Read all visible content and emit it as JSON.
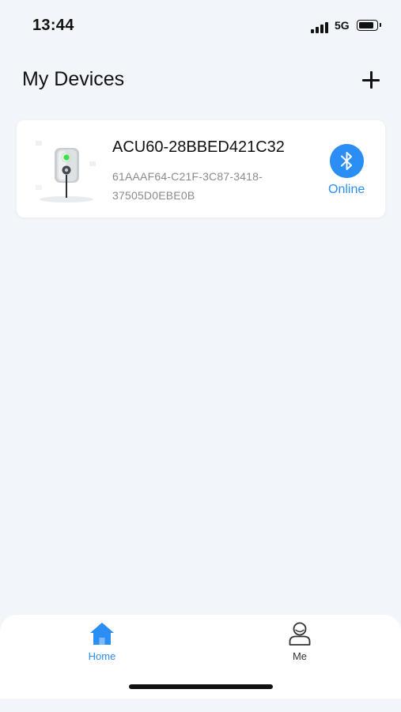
{
  "status_bar": {
    "time": "13:44",
    "network": "5G",
    "icons": [
      "signal-icon",
      "battery-icon"
    ]
  },
  "header": {
    "title": "My Devices",
    "add_icon": "plus-icon"
  },
  "devices": [
    {
      "name": "ACU60-28BBED421C32",
      "id": "61AAAF64-C21F-3C87-3418-37505D0EBE0B",
      "id_line1": "61AAAF64-C21F-3C87-3418-",
      "id_line2": "37505D0EBE0B",
      "connection_icon": "bluetooth-icon",
      "status": "Online"
    }
  ],
  "bottom_nav": {
    "tabs": [
      {
        "label": "Home",
        "icon": "home-icon",
        "active": true
      },
      {
        "label": "Me",
        "icon": "user-icon",
        "active": false
      }
    ]
  },
  "colors": {
    "accent": "#2a8ef5",
    "background": "#f2f5f9",
    "card": "#ffffff",
    "muted_text": "#8b8b8b"
  }
}
